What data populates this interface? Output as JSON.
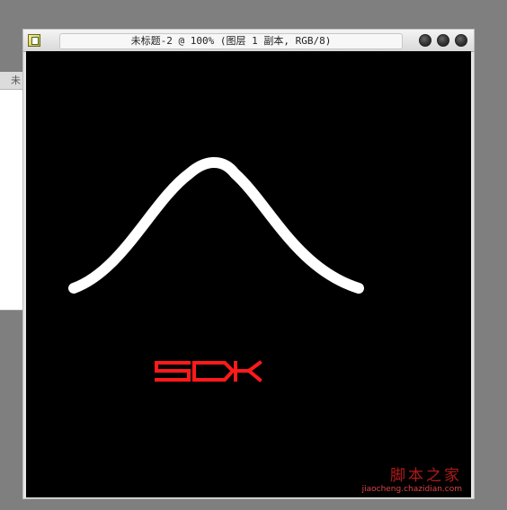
{
  "background_window": {
    "tab_label": "未"
  },
  "document_window": {
    "title": "未标题-2 @ 100% (图层 1 副本, RGB/8)",
    "buttons": [
      {
        "name": "minimize"
      },
      {
        "name": "maximize"
      },
      {
        "name": "close"
      }
    ]
  },
  "canvas": {
    "background": "#000000",
    "curve_color": "#ffffff",
    "text": "SDK",
    "text_color": "#ff1a1a"
  },
  "watermark": {
    "main": "脚本之家",
    "url": "jiaocheng.chazidian.com",
    "color": "#cf1f1f"
  }
}
